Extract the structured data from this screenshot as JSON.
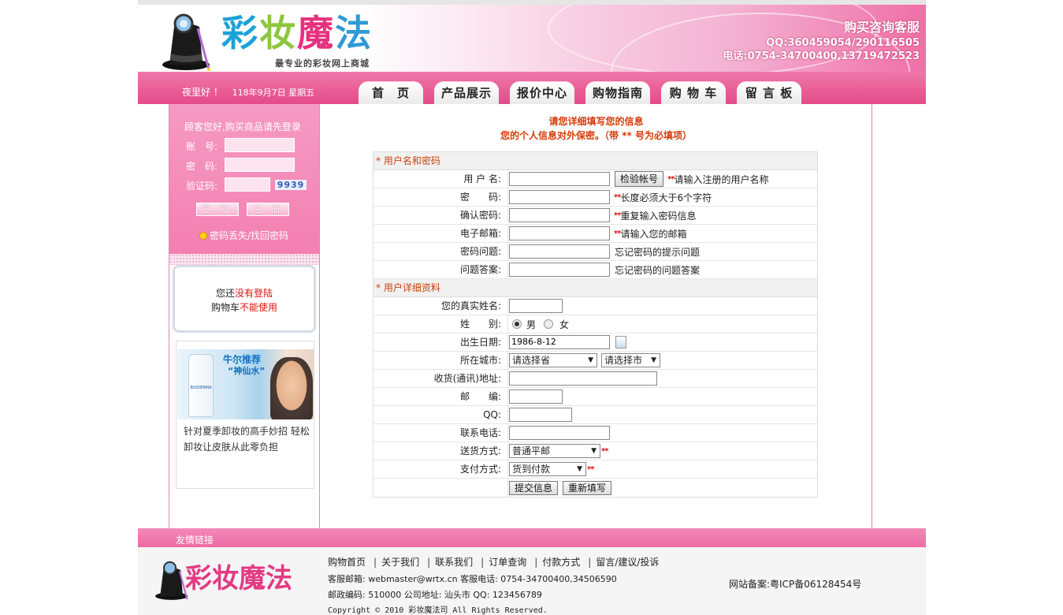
{
  "header": {
    "logo_text": [
      "彩",
      "妆",
      "魔",
      "法"
    ],
    "slogan": "最专业的彩妆网上商城",
    "service_title": "购买咨询客服",
    "service_qq": "QQ:360459054/290116505",
    "service_tel": "电话:0754-34700400,13719472523"
  },
  "navbar": {
    "greeting": "夜里好 ！",
    "date": "118年9月7日 星期五",
    "tabs": [
      {
        "label": "首　页"
      },
      {
        "label": "产品展示"
      },
      {
        "label": "报价中心"
      },
      {
        "label": "购物指南"
      },
      {
        "label": "购 物 车"
      },
      {
        "label": "留 言 板"
      }
    ]
  },
  "login": {
    "prompt": "顾客您好,购买商品请先登录",
    "account_label": "账　号:",
    "password_label": "密　码:",
    "captcha_label": "验证码:",
    "captcha_value": "9939",
    "login_button": "登 陆",
    "register_button": "注 册",
    "forgot": "密码丢失/找回密码"
  },
  "cart": {
    "line1_prefix": "您还",
    "line1_red": "没有登陆",
    "line2_prefix": "购物车",
    "line2_red": "不能使用"
  },
  "promo": {
    "tag1": "牛尔推荐",
    "tag2": "“神仙水”",
    "bottle_label": "BIODERMA",
    "text": "针对夏季卸妆的高手妙招 轻松卸妆让皮肤从此零负担"
  },
  "main": {
    "notice1": "请您详细填写您的信息",
    "notice2": "您的个人信息对外保密。（带 ** 号为必填项）",
    "section1": "* 用户名和密码",
    "section2": "* 用户详细资料",
    "fields": {
      "username": {
        "label": "用 户 名:",
        "hint": "请输入注册的用户名称",
        "button": "检验帐号"
      },
      "password": {
        "label": "密　　码:",
        "hint": "长度必须大于6个字符"
      },
      "confirm": {
        "label": "确认密码:",
        "hint": "重复输入密码信息"
      },
      "email": {
        "label": "电子邮箱:",
        "hint": "请输入您的邮箱"
      },
      "question": {
        "label": "密码问题:",
        "hint": "忘记密码的提示问题"
      },
      "answer": {
        "label": "问题答案:",
        "hint": "忘记密码的问题答案"
      },
      "realname": {
        "label": "您的真实姓名:"
      },
      "gender": {
        "label": "姓　　别:",
        "male": "男",
        "female": "女"
      },
      "birthday": {
        "label": "出生日期:",
        "value": "1986-8-12"
      },
      "city": {
        "label": "所在城市:",
        "province": "请选择省",
        "city": "请选择市"
      },
      "address": {
        "label": "收货(通讯)地址:"
      },
      "zip": {
        "label": "邮　　编:"
      },
      "qq": {
        "label": "QQ:"
      },
      "phone": {
        "label": "联系电话:"
      },
      "shipping": {
        "label": "送货方式:",
        "value": "普通平邮"
      },
      "payment": {
        "label": "支付方式:",
        "value": "货到付款"
      }
    },
    "req_mark": "**",
    "submit": "提交信息",
    "reset": "重新填写"
  },
  "footer": {
    "friend_links": "友情链接",
    "logo_text": "彩妆魔法",
    "nav": [
      "购物首页",
      "关于我们",
      "联系我们",
      "订单查询",
      "付款方式",
      "留言/建议/投诉"
    ],
    "info1": "客服邮箱: webmaster@wrtx.cn  客服电话: 0754-34700400,34506590",
    "info2": "邮政编码: 510000 公司地址: 汕头市 QQ: 123456789",
    "copyright": "Copyright © 2010 彩妆魔法司 All Rights Reserved.",
    "beian": "网站备案:粤ICP备06128454号"
  }
}
